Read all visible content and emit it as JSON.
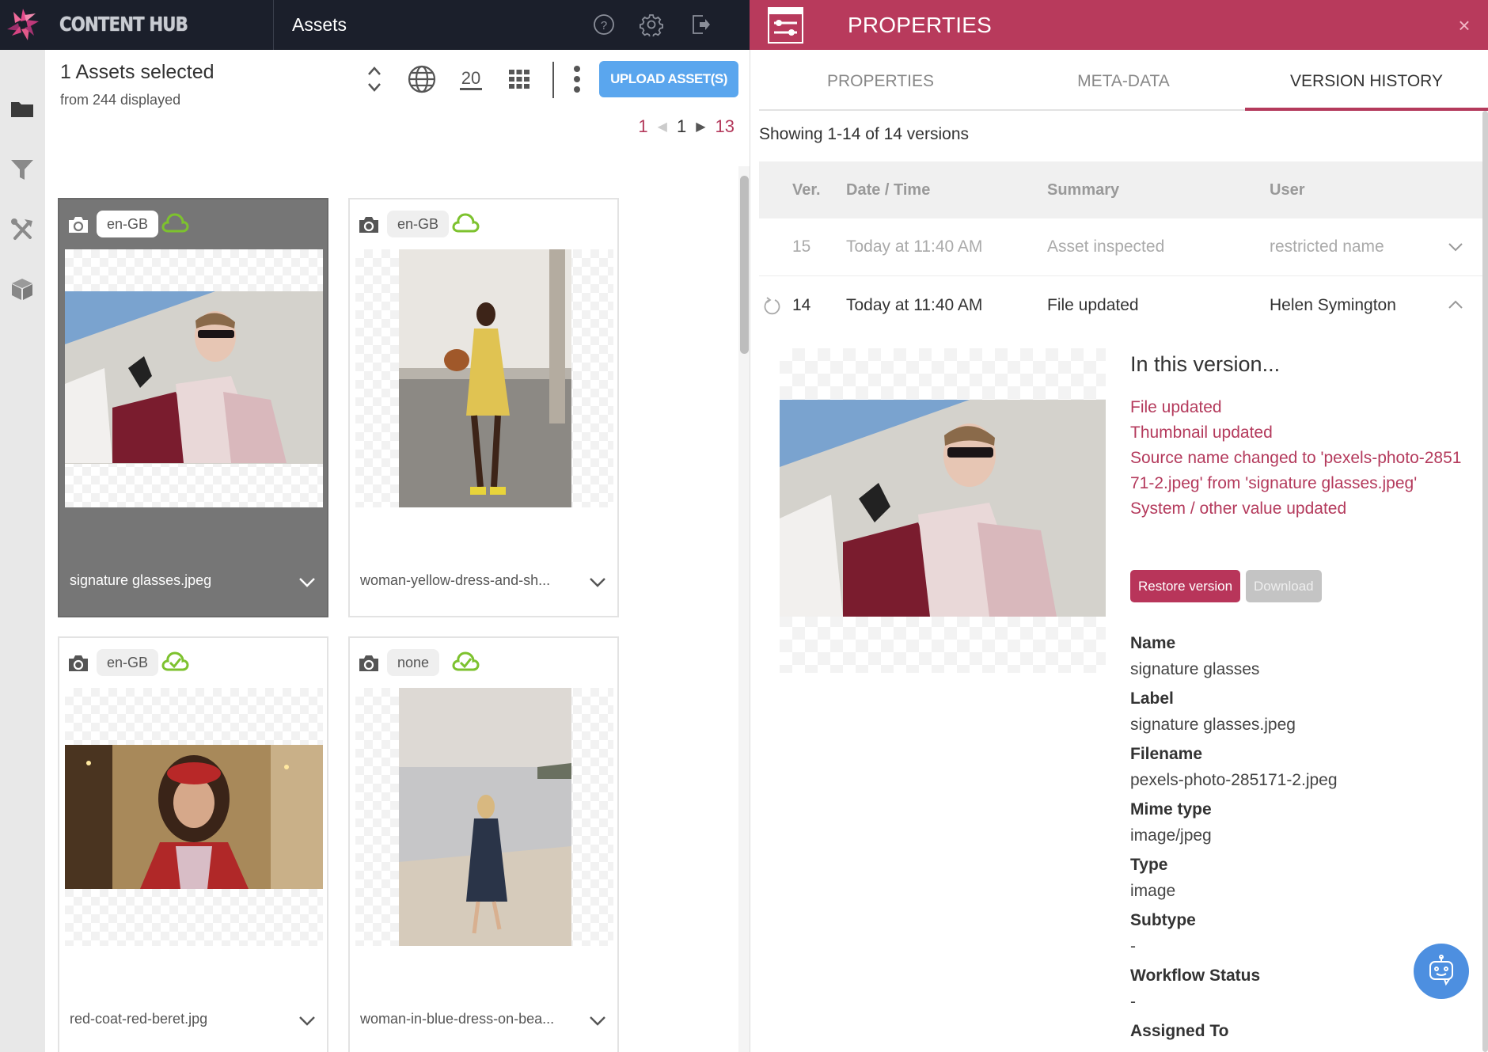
{
  "topbar": {
    "brand": "CONTENT HUB",
    "title": "Assets",
    "icons": [
      "help-icon",
      "settings-gear-icon",
      "logout-icon"
    ]
  },
  "sidebar": {
    "items": [
      {
        "name": "folder",
        "icon": "folder-icon"
      },
      {
        "name": "filter",
        "icon": "filter-funnel-icon"
      },
      {
        "name": "tools",
        "icon": "tools-icon"
      },
      {
        "name": "package",
        "icon": "cube-icon"
      }
    ]
  },
  "assets": {
    "selected_label": "1 Assets selected",
    "displayed_label": "from 244 displayed",
    "per_page": "20",
    "upload_label": "UPLOAD ASSET(S)",
    "pager": {
      "first": "1",
      "current": "1",
      "last": "13"
    },
    "cards": [
      {
        "filename": "signature glasses.jpeg",
        "locale": "en-GB",
        "cloud": "cloud-outline",
        "selected": true
      },
      {
        "filename": "woman-yellow-dress-and-sh...",
        "locale": "en-GB",
        "cloud": "cloud-outline",
        "selected": false
      },
      {
        "filename": "red-coat-red-beret.jpg",
        "locale": "en-GB",
        "cloud": "cloud-check",
        "selected": false
      },
      {
        "filename": "woman-in-blue-dress-on-bea...",
        "locale": "none",
        "cloud": "cloud-check",
        "selected": false
      }
    ]
  },
  "properties_panel": {
    "title": "PROPERTIES",
    "close": "×",
    "tabs": [
      {
        "label": "PROPERTIES",
        "active": false
      },
      {
        "label": "META-DATA",
        "active": false
      },
      {
        "label": "VERSION HISTORY",
        "active": true
      }
    ],
    "showing": "Showing 1-14 of 14 versions",
    "columns": [
      "Ver.",
      "Date / Time",
      "Summary",
      "User"
    ],
    "versions": [
      {
        "ver": "15",
        "date": "Today at 11:40 AM",
        "summary": "Asset inspected",
        "user": "restricted name",
        "expanded": false
      },
      {
        "ver": "14",
        "date": "Today at 11:40 AM",
        "summary": "File updated",
        "user": "Helen Symington",
        "expanded": true
      }
    ],
    "detail": {
      "title": "In this version...",
      "changes": [
        "File updated",
        "Thumbnail updated",
        "Source name changed to 'pexels-photo-285171-2.jpeg' from 'signature glasses.jpeg'",
        "System / other value updated"
      ],
      "restore_label": "Restore version",
      "download_label": "Download",
      "properties": [
        {
          "label": "Name",
          "value": "signature glasses"
        },
        {
          "label": "Label",
          "value": "signature glasses.jpeg"
        },
        {
          "label": "Filename",
          "value": "pexels-photo-285171-2.jpeg"
        },
        {
          "label": "Mime type",
          "value": "image/jpeg"
        },
        {
          "label": "Type",
          "value": "image"
        },
        {
          "label": "Subtype",
          "value": "-"
        },
        {
          "label": "Workflow Status",
          "value": "-"
        },
        {
          "label": "Assigned To",
          "value": ""
        }
      ]
    }
  },
  "colors": {
    "topbar_bg": "#1b1f2b",
    "accent": "#b83a5c",
    "upload_button": "#5aa6ee",
    "cloud_green": "#7dc22e",
    "selected_card": "#767676",
    "bot_button": "#4d8fe0"
  }
}
